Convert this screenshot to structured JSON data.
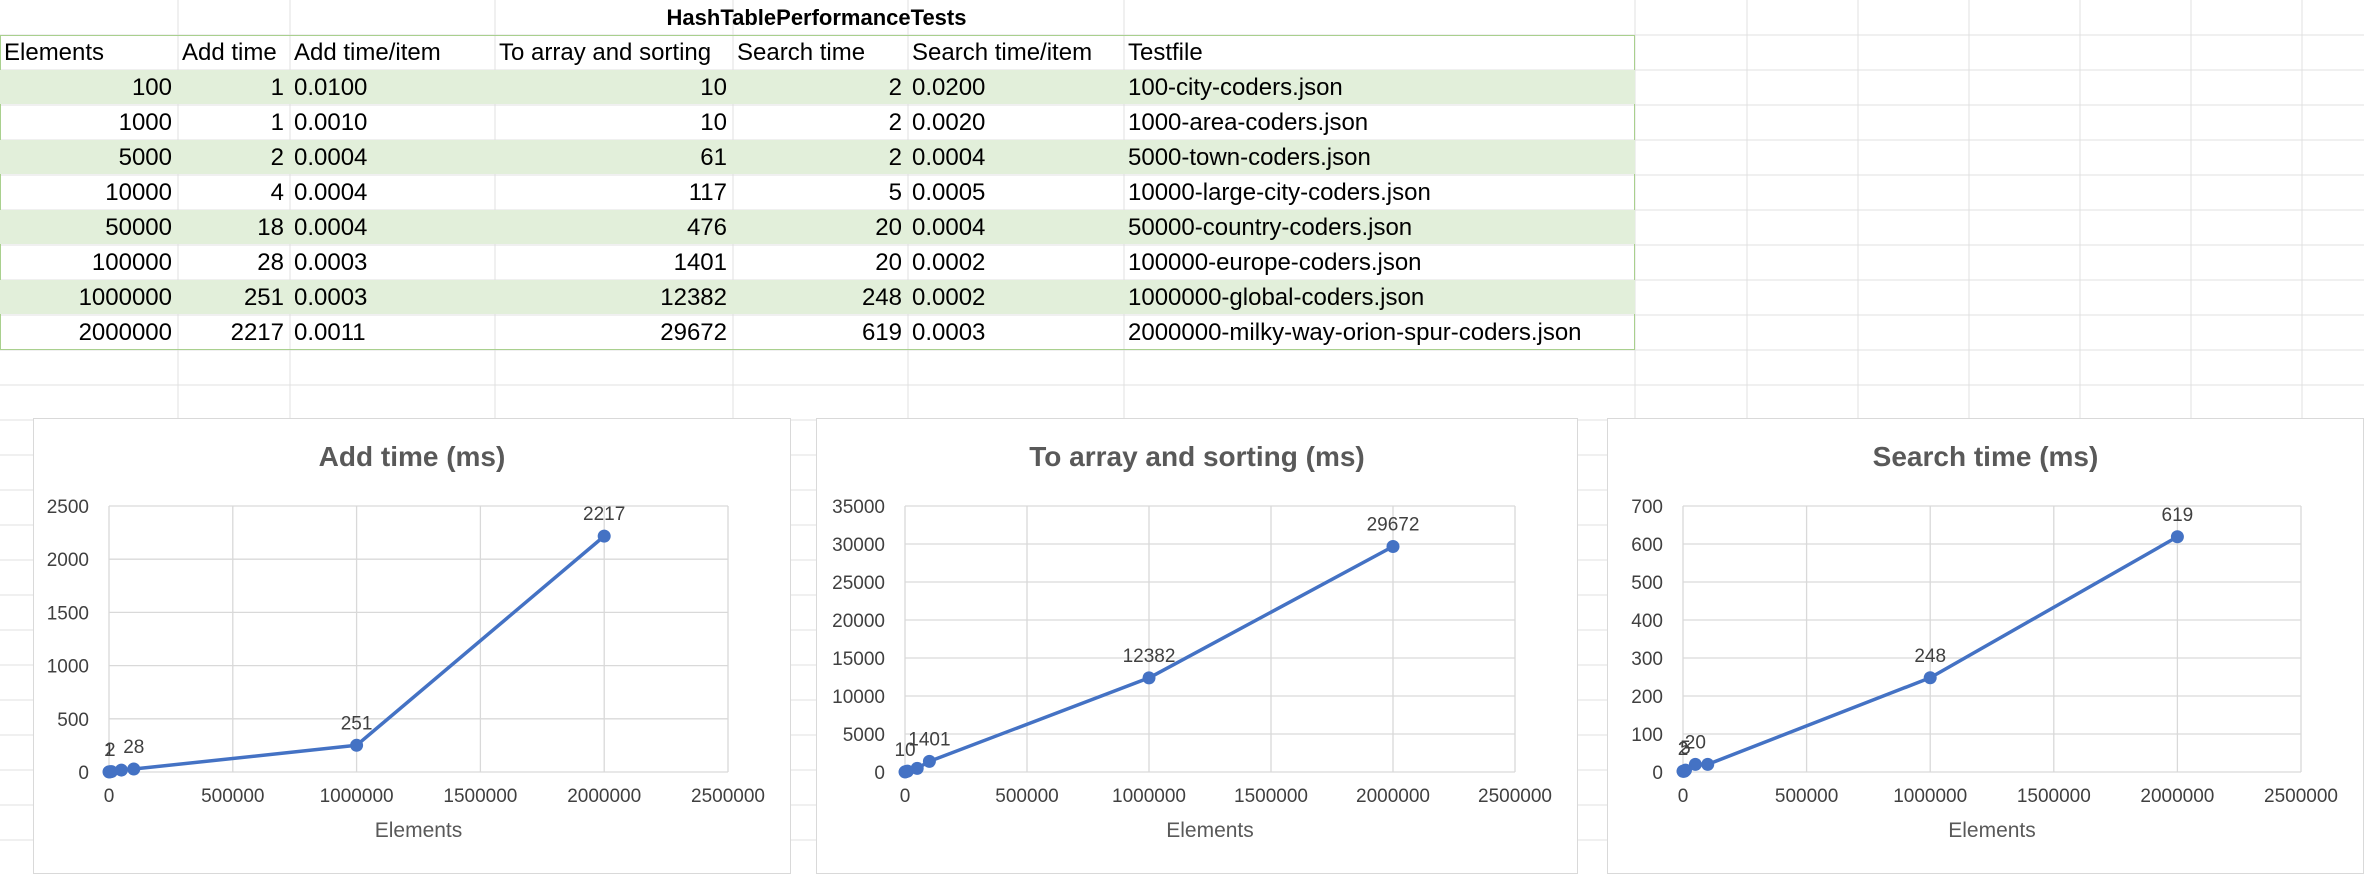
{
  "sheet": {
    "title": "HashTablePerformanceTests",
    "columns": [
      "Elements",
      "Add time",
      "Add time/item",
      "To array and sorting",
      "Search time",
      "Search time/item",
      "Testfile"
    ],
    "rows": [
      [
        "100",
        "1",
        "0.0100",
        "10",
        "2",
        "0.0200",
        "100-city-coders.json"
      ],
      [
        "1000",
        "1",
        "0.0010",
        "10",
        "2",
        "0.0020",
        "1000-area-coders.json"
      ],
      [
        "5000",
        "2",
        "0.0004",
        "61",
        "2",
        "0.0004",
        "5000-town-coders.json"
      ],
      [
        "10000",
        "4",
        "0.0004",
        "117",
        "5",
        "0.0005",
        "10000-large-city-coders.json"
      ],
      [
        "50000",
        "18",
        "0.0004",
        "476",
        "20",
        "0.0004",
        "50000-country-coders.json"
      ],
      [
        "100000",
        "28",
        "0.0003",
        "1401",
        "20",
        "0.0002",
        "100000-europe-coders.json"
      ],
      [
        "1000000",
        "251",
        "0.0003",
        "12382",
        "248",
        "0.0002",
        "1000000-global-coders.json"
      ],
      [
        "2000000",
        "2217",
        "0.0011",
        "29672",
        "619",
        "0.0003",
        "2000000-milky-way-orion-spur-coders.json"
      ]
    ],
    "colors": {
      "band": "#e2efda",
      "table_border": "#a9d08e",
      "gridline": "#e1e1e1"
    }
  },
  "chart_data": [
    {
      "type": "scatter",
      "title": "Add time (ms)",
      "xlabel": "Elements",
      "ylabel": "",
      "x": [
        100,
        1000,
        5000,
        10000,
        50000,
        100000,
        1000000,
        2000000
      ],
      "series": [
        {
          "values": [
            1,
            1,
            2,
            4,
            18,
            28,
            251,
            2217
          ],
          "color": "#4472c4"
        }
      ],
      "xlim": [
        0,
        2500000
      ],
      "ylim": [
        0,
        2500
      ],
      "xticks": [
        0,
        500000,
        1000000,
        1500000,
        2000000,
        2500000
      ],
      "yticks": [
        0,
        500,
        1000,
        1500,
        2000,
        2500
      ],
      "data_labels": [
        {
          "index": 0,
          "text": "1"
        },
        {
          "index": 2,
          "text": "2"
        },
        {
          "index": 5,
          "text": "28"
        },
        {
          "index": 6,
          "text": "251"
        },
        {
          "index": 7,
          "text": "2217"
        }
      ],
      "grid": true
    },
    {
      "type": "scatter",
      "title": "To array and sorting (ms)",
      "xlabel": "Elements",
      "ylabel": "",
      "x": [
        100,
        1000,
        5000,
        10000,
        50000,
        100000,
        1000000,
        2000000
      ],
      "series": [
        {
          "values": [
            10,
            10,
            61,
            117,
            476,
            1401,
            12382,
            29672
          ],
          "color": "#4472c4"
        }
      ],
      "xlim": [
        0,
        2500000
      ],
      "ylim": [
        0,
        35000
      ],
      "xticks": [
        0,
        500000,
        1000000,
        1500000,
        2000000,
        2500000
      ],
      "yticks": [
        0,
        5000,
        10000,
        15000,
        20000,
        25000,
        30000,
        35000
      ],
      "data_labels": [
        {
          "index": 0,
          "text": "10"
        },
        {
          "index": 5,
          "text": "1401"
        },
        {
          "index": 6,
          "text": "12382"
        },
        {
          "index": 7,
          "text": "29672"
        }
      ],
      "grid": true
    },
    {
      "type": "scatter",
      "title": "Search time (ms)",
      "xlabel": "Elements",
      "ylabel": "",
      "x": [
        100,
        1000,
        5000,
        10000,
        50000,
        100000,
        1000000,
        2000000
      ],
      "series": [
        {
          "values": [
            2,
            2,
            2,
            5,
            20,
            20,
            248,
            619
          ],
          "color": "#4472c4"
        }
      ],
      "xlim": [
        0,
        2500000
      ],
      "ylim": [
        0,
        700
      ],
      "xticks": [
        0,
        500000,
        1000000,
        1500000,
        2000000,
        2500000
      ],
      "yticks": [
        0,
        100,
        200,
        300,
        400,
        500,
        600,
        700
      ],
      "data_labels": [
        {
          "index": 0,
          "text": "2"
        },
        {
          "index": 3,
          "text": "5"
        },
        {
          "index": 4,
          "text": "20"
        },
        {
          "index": 6,
          "text": "248"
        },
        {
          "index": 7,
          "text": "619"
        }
      ],
      "grid": true
    }
  ]
}
